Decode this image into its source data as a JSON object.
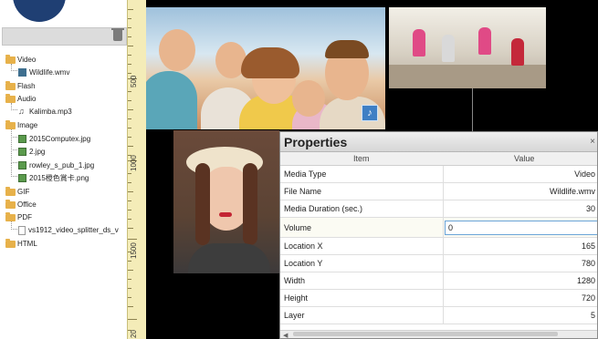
{
  "tree": {
    "items": [
      {
        "label": "Video",
        "type": "folder"
      },
      {
        "label": "Wildlife.wmv",
        "type": "video"
      },
      {
        "label": "Flash",
        "type": "folder"
      },
      {
        "label": "Audio",
        "type": "folder"
      },
      {
        "label": "Kalimba.mp3",
        "type": "music"
      },
      {
        "label": "Image",
        "type": "folder"
      },
      {
        "label": "2015Computex.jpg",
        "type": "image"
      },
      {
        "label": "2.jpg",
        "type": "image"
      },
      {
        "label": "rowley_s_pub_1.jpg",
        "type": "image"
      },
      {
        "label": "2015橙色賞卡.png",
        "type": "image"
      },
      {
        "label": "GIF",
        "type": "folder"
      },
      {
        "label": "Office",
        "type": "folder"
      },
      {
        "label": "PDF",
        "type": "folder"
      },
      {
        "label": "vs1912_video_splitter_ds_v",
        "type": "document"
      },
      {
        "label": "HTML",
        "type": "folder"
      }
    ]
  },
  "ruler": {
    "labels": [
      "500",
      "1000",
      "1500",
      "20"
    ]
  },
  "properties": {
    "title": "Properties",
    "close": "×",
    "col_item": "Item",
    "col_value": "Value",
    "rows": [
      {
        "key": "Media Type",
        "value": "Video"
      },
      {
        "key": "File Name",
        "value": "Wildlife.wmv"
      },
      {
        "key": "Media Duration (sec.)",
        "value": "30"
      },
      {
        "key": "Volume",
        "value": "0"
      },
      {
        "key": "Location X",
        "value": "165"
      },
      {
        "key": "Location Y",
        "value": "780"
      },
      {
        "key": "Width",
        "value": "1280"
      },
      {
        "key": "Height",
        "value": "720"
      },
      {
        "key": "Layer",
        "value": "5"
      }
    ]
  },
  "icons": {
    "delete": "trash-icon",
    "audio_badge": "music-note-icon",
    "folder": "folder-icon"
  },
  "colors": {
    "accent": "#3f7fc4",
    "folder": "#e7b14a",
    "ruler": "#f4ecb8"
  }
}
